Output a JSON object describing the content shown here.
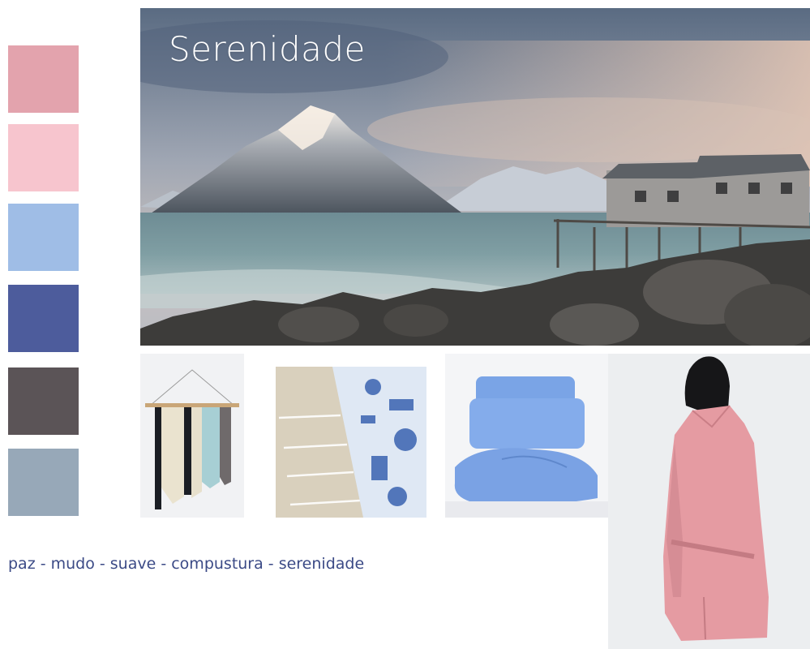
{
  "title": "Serenidade",
  "keywords": "paz - mudo - suave - compustura - serenidade",
  "palette": [
    {
      "name": "rose",
      "hex": "#E3A3AD"
    },
    {
      "name": "light-pink",
      "hex": "#F7C5CE"
    },
    {
      "name": "light-blue",
      "hex": "#9FBDE6"
    },
    {
      "name": "indigo",
      "hex": "#4D5C9C"
    },
    {
      "name": "charcoal",
      "hex": "#5B5457"
    },
    {
      "name": "blue-gray",
      "hex": "#97A8B8"
    }
  ],
  "images": [
    {
      "subject": "mountain-lake-landscape"
    },
    {
      "subject": "yarn-wall-hanging"
    },
    {
      "subject": "linen-and-blue-patterned-fabric"
    },
    {
      "subject": "blue-bedding"
    },
    {
      "subject": "woman-in-pink-coat"
    }
  ]
}
